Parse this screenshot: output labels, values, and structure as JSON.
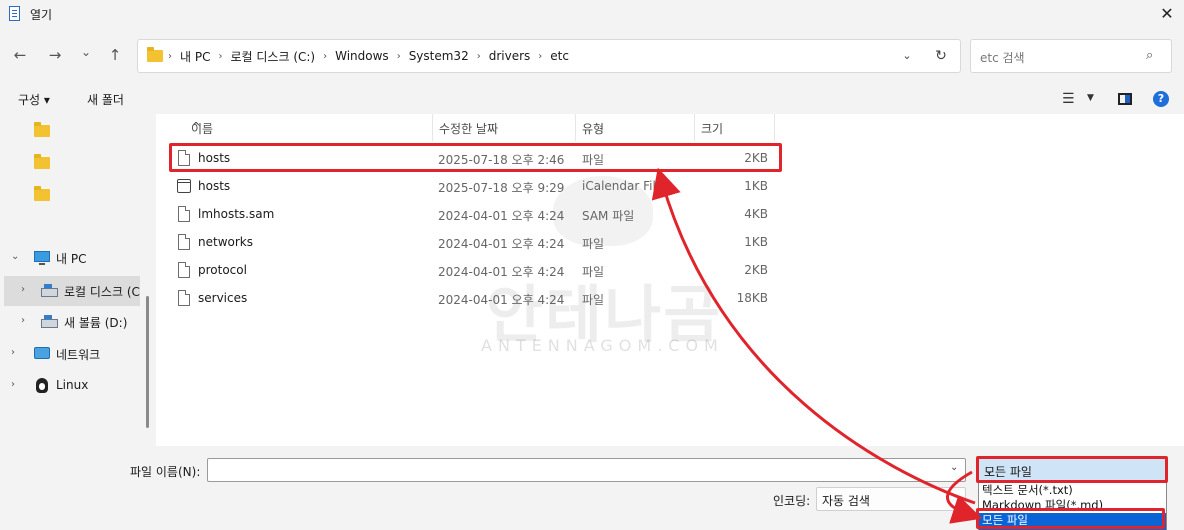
{
  "window": {
    "title": "열기",
    "close_glyph": "✕"
  },
  "nav": {
    "back_glyph": "←",
    "forward_glyph": "→",
    "recent_glyph": "⌄",
    "up_glyph": "↑",
    "breadcrumbs": [
      "내 PC",
      "로컬 디스크 (C:)",
      "Windows",
      "System32",
      "drivers",
      "etc"
    ],
    "crumb_sep": "›",
    "dropdown_glyph": "⌄",
    "refresh_glyph": "↻",
    "search_placeholder": "etc 검색",
    "search_glyph": "⌕"
  },
  "commandbar": {
    "organize": "구성 ▾",
    "new_folder": "새 폴더",
    "view_glyph": "☰",
    "view_dd_glyph": "▼",
    "help_glyph": "?"
  },
  "navpane": {
    "items": [
      {
        "label": "",
        "icon": "folder-icon"
      },
      {
        "label": "",
        "icon": "folder-icon"
      },
      {
        "label": "",
        "icon": "folder-icon"
      },
      {
        "label": "내 PC",
        "icon": "pc-icon",
        "chevron": "⌄"
      },
      {
        "label": "로컬 디스크 (C",
        "icon": "drive-icon",
        "chevron": "›",
        "selected": true
      },
      {
        "label": "새 볼륨 (D:)",
        "icon": "drive-icon",
        "chevron": "›"
      },
      {
        "label": "네트워크",
        "icon": "network-icon",
        "chevron": "›"
      },
      {
        "label": "Linux",
        "icon": "linux-icon",
        "chevron": "›"
      }
    ]
  },
  "filelist": {
    "columns": [
      "이름",
      "수정한 날짜",
      "유형",
      "크기"
    ],
    "sort_glyph": "^",
    "rows": [
      {
        "name": "hosts",
        "date": "2025-07-18 오후 2:46",
        "type": "파일",
        "size": "2KB",
        "icon": "file-icon"
      },
      {
        "name": "hosts",
        "date": "2025-07-18 오후 9:29",
        "type": "iCalendar File",
        "size": "1KB",
        "icon": "calendar-icon"
      },
      {
        "name": "lmhosts.sam",
        "date": "2024-04-01 오후 4:24",
        "type": "SAM 파일",
        "size": "4KB",
        "icon": "file-icon"
      },
      {
        "name": "networks",
        "date": "2024-04-01 오후 4:24",
        "type": "파일",
        "size": "1KB",
        "icon": "file-icon"
      },
      {
        "name": "protocol",
        "date": "2024-04-01 오후 4:24",
        "type": "파일",
        "size": "2KB",
        "icon": "file-icon"
      },
      {
        "name": "services",
        "date": "2024-04-01 오후 4:24",
        "type": "파일",
        "size": "18KB",
        "icon": "file-icon"
      }
    ]
  },
  "watermark": {
    "main": "안테나곰",
    "sub": "ANTENNAGOM.COM"
  },
  "bottom": {
    "filename_label": "파일 이름(N):",
    "filename_value": "",
    "filename_dd_glyph": "⌄",
    "encoding_label": "인코딩:",
    "encoding_value": "자동 검색",
    "filetype_value": "모든 파일",
    "filetype_dd_glyph": "⌄",
    "filetype_options": [
      "텍스트 문서(*.txt)",
      "Markdown 파일(*.md)",
      "모든 파일"
    ],
    "filetype_selected_index": 2
  },
  "colors": {
    "annotation": "#e0242c",
    "accent": "#0a64d6"
  }
}
